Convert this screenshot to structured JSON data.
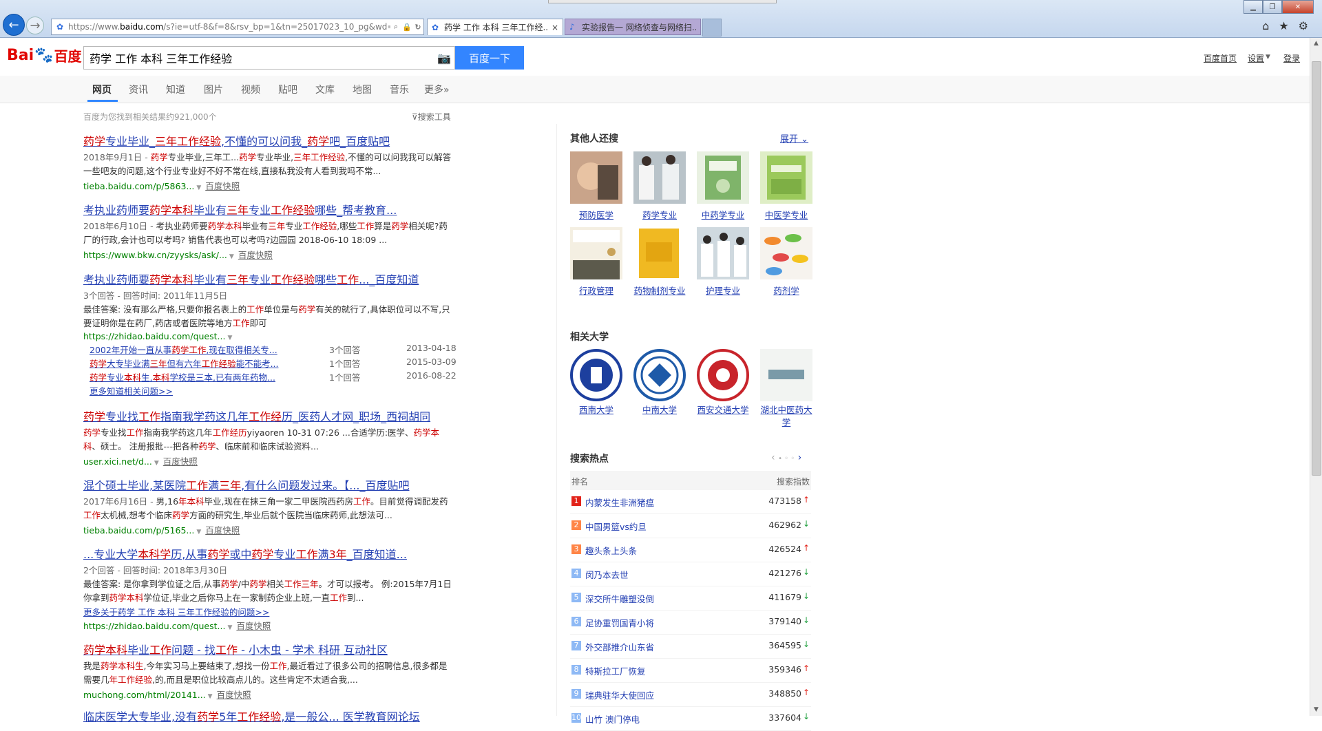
{
  "browser": {
    "url_prefix": "https://www.",
    "url_host": "baidu.com",
    "url_rest": "/s?ie=utf-8&f=8&rsv_bp=1&tn=25017023_10_pg&wd=",
    "tabs": [
      {
        "label": "药学 工作 本科 三年工作经...",
        "close": "×"
      },
      {
        "label": "实验报告一 网络侦查与网络扫..."
      }
    ],
    "back_icon": "←",
    "forward_icon": "→"
  },
  "header": {
    "logo_bai": "Bai",
    "logo_du": "du",
    "logo_cn": "百度",
    "query": "药学 工作 本科 三年工作经验",
    "search_button": "百度一下",
    "links": {
      "home": "百度首页",
      "settings": "设置",
      "login": "登录"
    }
  },
  "nav": {
    "tabs": [
      "网页",
      "资讯",
      "知道",
      "图片",
      "视频",
      "贴吧",
      "文库",
      "地图",
      "音乐",
      "更多»"
    ]
  },
  "meta": {
    "result_count": "百度为您找到相关结果约921,000个",
    "search_tools": "搜索工具"
  },
  "results": [
    {
      "title_parts": [
        [
          "药学",
          "r"
        ],
        [
          "专业毕业_",
          ""
        ],
        [
          "三年工作经验",
          "r"
        ],
        [
          ",不懂的可以问我_",
          ""
        ],
        [
          "药学",
          "r"
        ],
        [
          "吧_百度贴吧",
          ""
        ]
      ],
      "abs_parts": [
        [
          "2018年9月1日 - ",
          "d"
        ],
        [
          "药学",
          "r"
        ],
        [
          "专业毕业,三年工...",
          ""
        ],
        [
          "药学",
          "r"
        ],
        [
          "专业毕业,",
          ""
        ],
        [
          "三年工作经验",
          "r"
        ],
        [
          ",不懂的可以问我我可以解答一些吧友的问题,这个行业专业好不好不常在线,直接私我没有人看到我吗不常...",
          ""
        ]
      ],
      "url": "tieba.baidu.com/p/5863...",
      "snapshot": "百度快照"
    },
    {
      "title_parts": [
        [
          "考执业药师要",
          ""
        ],
        [
          "药学本科",
          "r"
        ],
        [
          "毕业有",
          ""
        ],
        [
          "三年",
          "r"
        ],
        [
          "专业",
          ""
        ],
        [
          "工作经验",
          "r"
        ],
        [
          "哪些_帮考教育...",
          ""
        ]
      ],
      "abs_parts": [
        [
          "2018年6月10日 - ",
          "d"
        ],
        [
          "考执业药师要",
          ""
        ],
        [
          "药学本科",
          "r"
        ],
        [
          "毕业有",
          ""
        ],
        [
          "三年",
          "r"
        ],
        [
          "专业",
          ""
        ],
        [
          "工作经验",
          "r"
        ],
        [
          ",哪些",
          ""
        ],
        [
          "工作",
          "r"
        ],
        [
          "算是",
          ""
        ],
        [
          "药学",
          "r"
        ],
        [
          "相关呢?药厂的行政,会计也可以考吗? 销售代表也可以考吗?边园园 2018-06-10 18:09 ...",
          ""
        ]
      ],
      "url": "https://www.bkw.cn/zyysks/ask/...",
      "snapshot": "百度快照"
    },
    {
      "title_parts": [
        [
          "考执业药师要",
          ""
        ],
        [
          "药学本科",
          "r"
        ],
        [
          "毕业有",
          ""
        ],
        [
          "三年",
          "r"
        ],
        [
          "专业",
          ""
        ],
        [
          "工作经验",
          "r"
        ],
        [
          "哪些",
          ""
        ],
        [
          "工作",
          "r"
        ],
        [
          "..._百度知道",
          ""
        ]
      ],
      "meta_line": "3个回答 - 回答时间: 2011年11月5日",
      "abs_parts": [
        [
          "最佳答案: 没有那么严格,只要你报名表上的",
          ""
        ],
        [
          "工作",
          "r"
        ],
        [
          "单位是与",
          ""
        ],
        [
          "药学",
          "r"
        ],
        [
          "有关的就行了,具体职位可以不写,只要证明你是在药厂,药店或者医院等地方",
          ""
        ],
        [
          "工作",
          "r"
        ],
        [
          "即可",
          ""
        ]
      ],
      "url": "https://zhidao.baidu.com/quest...",
      "snapshot": ""
    },
    {
      "title_parts": [
        [
          "药学",
          "r"
        ],
        [
          "专业找",
          ""
        ],
        [
          "工作",
          "r"
        ],
        [
          "指南我学药这几年",
          ""
        ],
        [
          "工作经",
          "r"
        ],
        [
          "历_医药人才网_职场_西祠胡同",
          ""
        ]
      ],
      "abs_parts": [
        [
          "药学",
          "r"
        ],
        [
          "专业找",
          ""
        ],
        [
          "工作",
          "r"
        ],
        [
          "指南我学药这几年",
          ""
        ],
        [
          "工作经历",
          "r"
        ],
        [
          "yiyaoren 10-31 07:26 ...合适学历:医学、",
          ""
        ],
        [
          "药学本科",
          "r"
        ],
        [
          "、硕士。 注册报批---把各种",
          ""
        ],
        [
          "药学",
          "r"
        ],
        [
          "、临床前和临床试验资料...",
          ""
        ]
      ],
      "url": "user.xici.net/d...",
      "snapshot": "百度快照"
    },
    {
      "title_parts": [
        [
          "混个硕士毕业,某医院",
          ""
        ],
        [
          "工作",
          "r"
        ],
        [
          "满",
          ""
        ],
        [
          "三年",
          "r"
        ],
        [
          ",有什么问题发过来。【..._百度贴吧",
          ""
        ]
      ],
      "abs_parts": [
        [
          "2017年6月16日 - ",
          "d"
        ],
        [
          "男,16",
          ""
        ],
        [
          "年本科",
          "r"
        ],
        [
          "毕业,现在在抹三角一家二甲医院西药房",
          ""
        ],
        [
          "工作",
          "r"
        ],
        [
          "。目前觉得调配发药",
          ""
        ],
        [
          "工作",
          "r"
        ],
        [
          "太机械,想考个临床",
          ""
        ],
        [
          "药学",
          "r"
        ],
        [
          "方面的研究生,毕业后就个医院当临床药师,此想法可...",
          ""
        ]
      ],
      "url": "tieba.baidu.com/p/5165...",
      "snapshot": "百度快照"
    },
    {
      "title_parts": [
        [
          "...专业大学",
          ""
        ],
        [
          "本科学",
          "r"
        ],
        [
          "历,从事",
          ""
        ],
        [
          "药学",
          "r"
        ],
        [
          "或中",
          ""
        ],
        [
          "药学",
          "r"
        ],
        [
          "专业",
          ""
        ],
        [
          "工作",
          "r"
        ],
        [
          "满",
          ""
        ],
        [
          "3年",
          "r"
        ],
        [
          "_百度知道...",
          ""
        ]
      ],
      "meta_line": "2个回答 - 回答时间: 2018年3月30日",
      "abs_parts": [
        [
          "最佳答案: 是你拿到学位证之后,从事",
          ""
        ],
        [
          "药学",
          "r"
        ],
        [
          "/中",
          ""
        ],
        [
          "药学",
          "r"
        ],
        [
          "相关",
          ""
        ],
        [
          "工作三年",
          "r"
        ],
        [
          "。才可以报考。 例:2015年7月1日你拿到",
          ""
        ],
        [
          "药学本科",
          "r"
        ],
        [
          "学位证,毕业之后你马上在一家制药企业上班,一直",
          ""
        ],
        [
          "工作",
          "r"
        ],
        [
          "到...",
          ""
        ]
      ],
      "more_link": "更多关于药学 工作 本科 三年工作经验的问题>>",
      "url": "https://zhidao.baidu.com/quest...",
      "snapshot": "百度快照"
    },
    {
      "title_parts": [
        [
          "药学本科",
          "r"
        ],
        [
          "毕业",
          ""
        ],
        [
          "工作",
          "r"
        ],
        [
          "问题 - 找",
          ""
        ],
        [
          "工作",
          "r"
        ],
        [
          " - 小木虫 - 学术 科研 互动社区",
          ""
        ]
      ],
      "abs_parts": [
        [
          "我是",
          ""
        ],
        [
          "药学本科生",
          "r"
        ],
        [
          ",今年实习马上要结束了,想找一份",
          ""
        ],
        [
          "工作",
          "r"
        ],
        [
          ",最近看过了很多公司的招聘信息,很多都是需要几",
          ""
        ],
        [
          "年工作经验",
          "r"
        ],
        [
          ",的,而且是职位比较高点儿的。这些肯定不太适合我,...",
          ""
        ]
      ],
      "url": "muchong.com/html/20141...",
      "snapshot": "百度快照"
    },
    {
      "title_parts": [
        [
          "临床医学大专毕业,没有",
          ""
        ],
        [
          "药学",
          "r"
        ],
        [
          "5年",
          ""
        ],
        [
          "工作经验",
          "r"
        ],
        [
          ",是一般公... 医学教育网论坛",
          ""
        ]
      ]
    }
  ],
  "sub_questions": [
    {
      "q_parts": [
        [
          "2002年开始一直从事",
          ""
        ],
        [
          "药学工作",
          "r"
        ],
        [
          ",现在取得相关专...",
          ""
        ]
      ],
      "count": "3个回答",
      "date": "2013-04-18"
    },
    {
      "q_parts": [
        [
          "药学",
          "r"
        ],
        [
          "大专毕业满",
          ""
        ],
        [
          "三年",
          "r"
        ],
        [
          "但有六年",
          ""
        ],
        [
          "工作经验",
          "r"
        ],
        [
          "能不能考...",
          ""
        ]
      ],
      "count": "1个回答",
      "date": "2015-03-09"
    },
    {
      "q_parts": [
        [
          "药学",
          "r"
        ],
        [
          "专业",
          ""
        ],
        [
          "本科",
          "r"
        ],
        [
          "生,",
          ""
        ],
        [
          "本科",
          "r"
        ],
        [
          "学校是三本,已有两年药物...",
          ""
        ]
      ],
      "count": "1个回答",
      "date": "2016-08-22"
    }
  ],
  "more_zhidao": "更多知道相关问题>>",
  "sidebar": {
    "others_title": "其他人还搜",
    "expand": "展开",
    "others": [
      "预防医学",
      "药学专业",
      "中药学专业",
      "中医学专业",
      "行政管理",
      "药物制剂专业",
      "护理专业",
      "药剂学"
    ],
    "uni_title": "相关大学",
    "universities": [
      "西南大学",
      "中南大学",
      "西安交通大学",
      "湖北中医药大学"
    ],
    "hot_title": "搜索热点",
    "hot_head_rank": "排名",
    "hot_head_index": "搜索指数",
    "hot": [
      {
        "rank": "1",
        "title": "内蒙发生非洲猪瘟",
        "value": "473158",
        "dir": "up"
      },
      {
        "rank": "2",
        "title": "中国男篮vs约旦",
        "value": "462962",
        "dir": "down"
      },
      {
        "rank": "3",
        "title": "趣头条上头条",
        "value": "426524",
        "dir": "up"
      },
      {
        "rank": "4",
        "title": "闵乃本去世",
        "value": "421276",
        "dir": "down"
      },
      {
        "rank": "5",
        "title": "深交所牛雕塑没倒",
        "value": "411679",
        "dir": "down"
      },
      {
        "rank": "6",
        "title": "足协重罚国青小将",
        "value": "379140",
        "dir": "down"
      },
      {
        "rank": "7",
        "title": "外交部推介山东省",
        "value": "364595",
        "dir": "down"
      },
      {
        "rank": "8",
        "title": "特斯拉工厂恢复",
        "value": "359346",
        "dir": "up"
      },
      {
        "rank": "9",
        "title": "瑞典驻华大使回应",
        "value": "348850",
        "dir": "up"
      },
      {
        "rank": "10",
        "title": "山竹 澳门停电",
        "value": "337604",
        "dir": "down"
      }
    ],
    "colors": {
      "rank_top": "#e2231a",
      "rank_mid": "#ff8547",
      "rank_low": "#8eb9f5",
      "up": "#e2231a",
      "down": "#1c9e3b"
    }
  }
}
